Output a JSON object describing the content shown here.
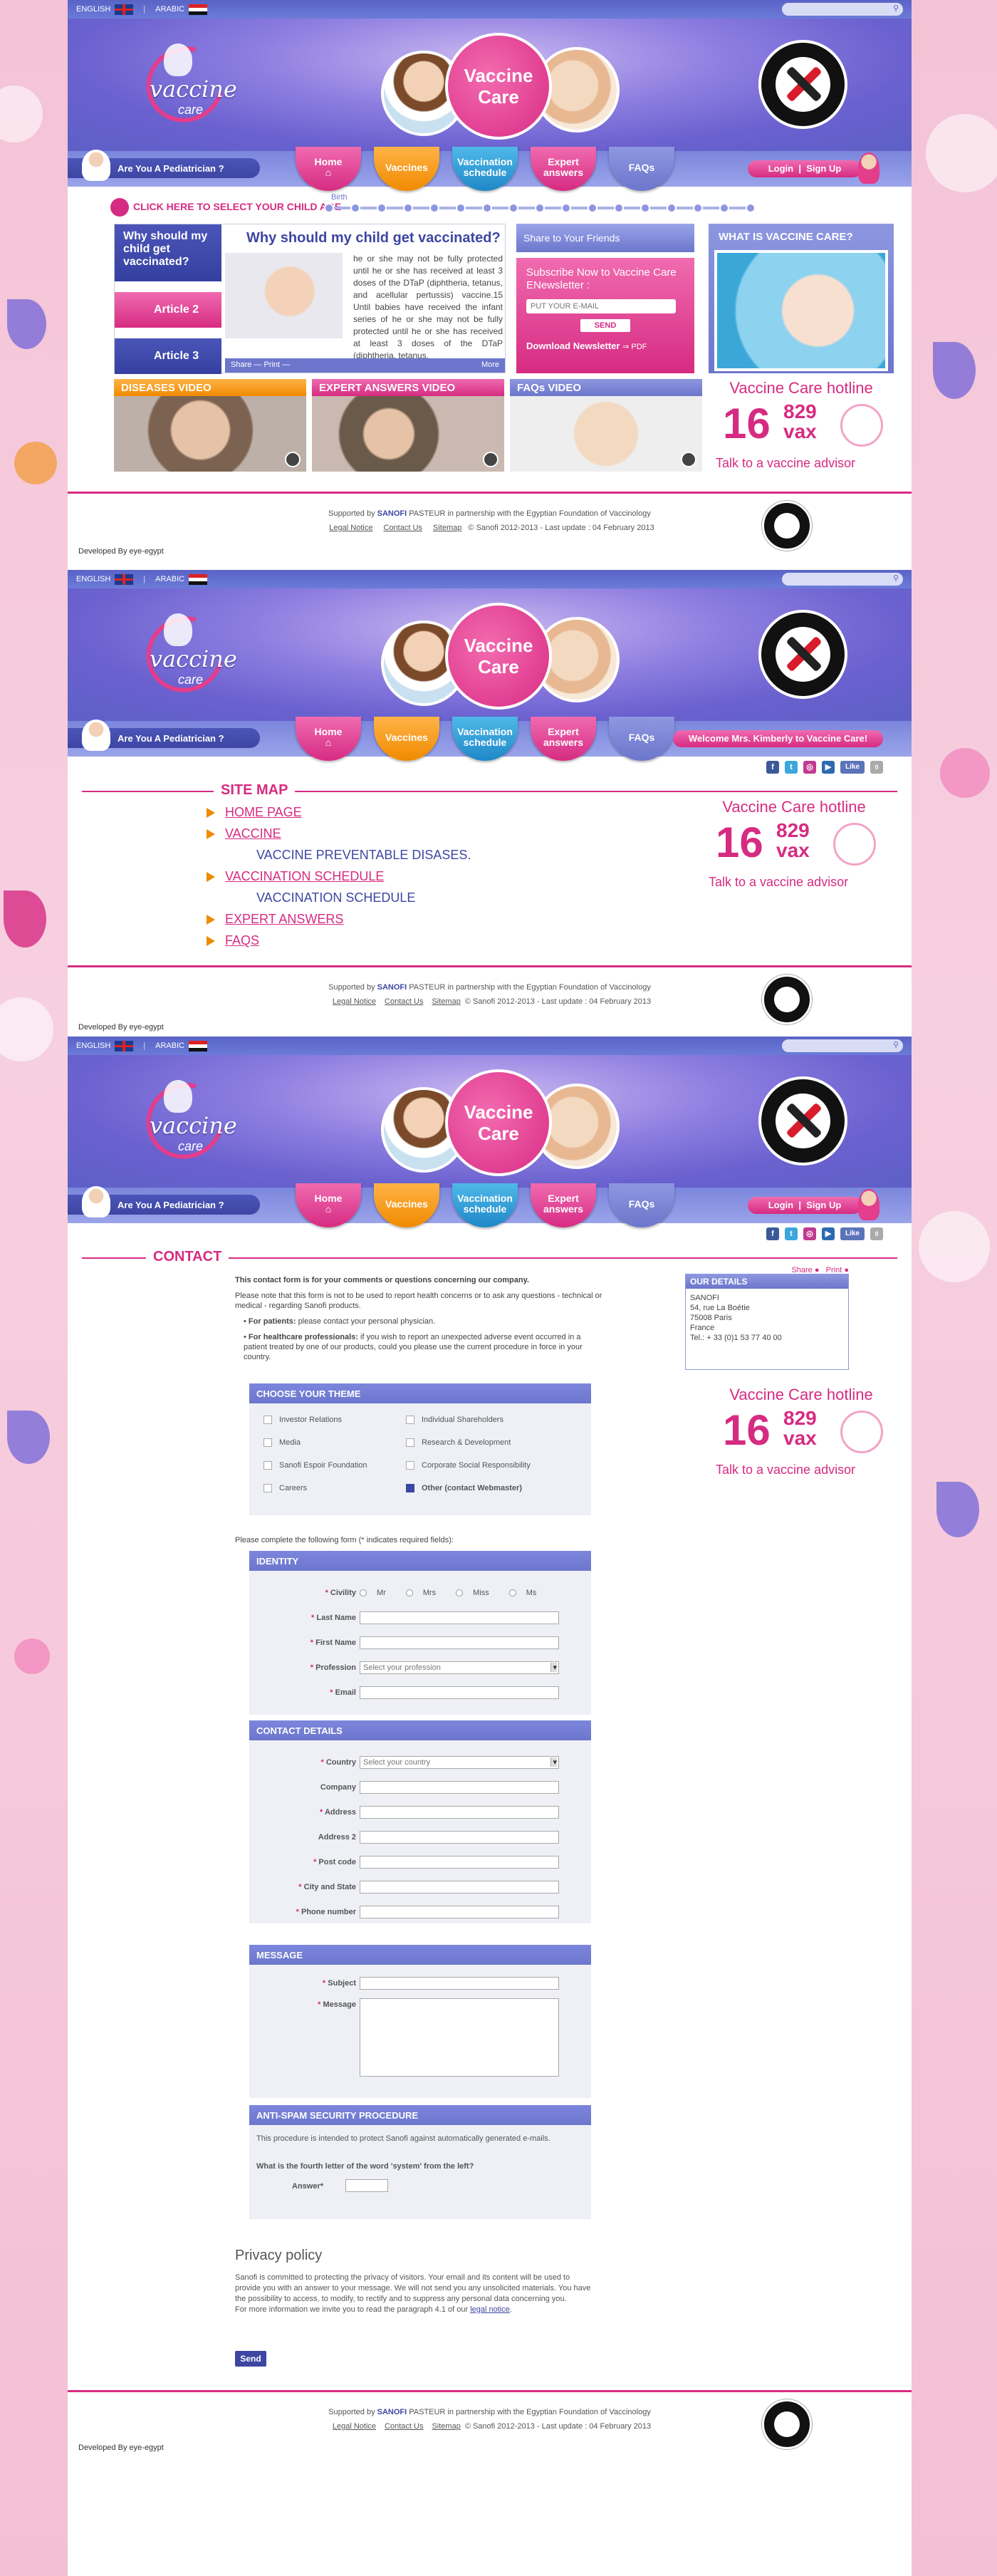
{
  "colors": {
    "brand_pink": "#d62b82",
    "brand_blue": "#3d46a2",
    "accent_orange": "#f08a00",
    "background_pink": "#f6c6da"
  },
  "top": {
    "lang_en": "ENGLISH",
    "lang_ar": "ARABIC",
    "search_placeholder": ""
  },
  "brand": {
    "logo_text": "vaccine",
    "logo_sub": "care",
    "hero_text_1": "Vaccine",
    "hero_text_2": "Care"
  },
  "nav": {
    "pediatrician": "Are You A Pediatrician ?",
    "home": "Home",
    "vaccines": "Vaccines",
    "schedule_1": "Vaccination",
    "schedule_2": "schedule",
    "expert_1": "Expert",
    "expert_2": "answers",
    "faqs": "FAQs",
    "login": "Login",
    "signup": "Sign Up",
    "welcome": "Welcome Mrs. Kimberly to Vaccine Care!"
  },
  "social": {
    "like": "Like",
    "count": "0"
  },
  "home": {
    "age_cta": "CLICK HERE TO SELECT YOUR CHILD AGE",
    "birth": "Birth",
    "article_tab_1": "Why should my child get vaccinated?",
    "article_tab_2": "Article 2",
    "article_tab_3": "Article 3",
    "article_title": "Why should my child get vaccinated?",
    "article_text": "he or she may not be fully protected until he or she has received at least 3 doses of the DTaP (diphtheria, tetanus, and acellular pertussis) vaccine.15 Until babies have received the infant series of he or she may not be fully protected until he or she has received at least 3 doses of the DTaP (diphtheria, tetanus,",
    "article_share": "Share — Print —",
    "article_more": "More",
    "share_friends": "Share to Your Friends",
    "newsletter_title": "Subscribe Now to Vaccine Care ENewsletter :",
    "email_placeholder": "PUT YOUR E-MAIL",
    "send": "SEND",
    "download": "Download Newsletter",
    "pdf": "PDF",
    "what_is": "WHAT IS VACCINE CARE?",
    "video_1": "DISEASES VIDEO",
    "video_2": "EXPERT ANSWERS VIDEO",
    "video_3": "FAQs  VIDEO"
  },
  "hotline": {
    "title": "Vaccine Care hotline",
    "number": "16",
    "num_small": "829",
    "vax": "vax",
    "sub": "Talk to a vaccine advisor"
  },
  "footer": {
    "supported": "Supported by",
    "sanofi": "SANOFI",
    "pasteur": "PASTEUR",
    "partnership": "in partnership with the Egyptian Foundation of Vaccinology",
    "legal": "Legal Notice",
    "contact": "Contact Us",
    "sitemap": "Sitemap",
    "copyright": "© Sanofi 2012-2013 - Last update : 04 February 2013",
    "developed": "Developed By eye-egypt"
  },
  "sitemap": {
    "title": "SITE MAP",
    "items": [
      {
        "label": "HOME PAGE",
        "sub": false
      },
      {
        "label": "VACCINE",
        "sub": false
      },
      {
        "label": "VACCINE PREVENTABLE DISASES.",
        "sub": true
      },
      {
        "label": "VACCINATION SCHEDULE",
        "sub": false
      },
      {
        "label": "VACCINATION SCHEDULE",
        "sub": true
      },
      {
        "label": "EXPERT ANSWERS",
        "sub": false
      },
      {
        "label": "FAQS",
        "sub": false
      }
    ]
  },
  "contact": {
    "title": "CONTACT",
    "share": "Share",
    "print": "Print",
    "intro_bold": "This contact form is for your comments or questions concerning our company.",
    "intro_2": "Please note that this form is not to be used to report health concerns or to ask any questions - technical or medical - regarding Sanofi products.",
    "patients_b": "For patients:",
    "patients": "please contact your personal physician.",
    "hcp_b": "For healthcare professionals:",
    "hcp": "if you wish to report an unexpected adverse event occurred in a patient treated by one of our products, could you please use the current procedure in force in your country.",
    "details_title": "OUR DETAILS",
    "details_lines": [
      "SANOFI",
      "54, rue La Boétie",
      "75008 Paris",
      "France",
      "Tel.: + 33 (0)1 53 77 40 00"
    ],
    "theme_title": "CHOOSE YOUR THEME",
    "themes": [
      "Investor Relations",
      "Media",
      "Sanofi Espoir Foundation",
      "Careers",
      "Individual Shareholders",
      "Research & Development",
      "Corporate Social Responsibility",
      "Other (contact Webmaster)"
    ],
    "fill_note": "Please complete the following form (* indicates required fields):",
    "identity_title": "IDENTITY",
    "civility": "Civility",
    "civ_opts": [
      "Mr",
      "Mrs",
      "Miss",
      "Ms"
    ],
    "last_name": "Last Name",
    "first_name": "First Name",
    "profession": "Profession",
    "profession_ph": "Select your profession",
    "email": "Email",
    "contact_title": "CONTACT DETAILS",
    "country": "Country",
    "country_ph": "Select your country",
    "company": "Company",
    "address": "Address",
    "address2": "Address 2",
    "post": "Post code",
    "city": "City and State",
    "phone": "Phone number",
    "message_title": "MESSAGE",
    "subject": "Subject",
    "message": "Message",
    "antispam_title": "ANTI-SPAM SECURITY PROCEDURE",
    "antispam_text": "This procedure is intended to protect Sanofi against automatically generated e-mails.",
    "question": "What is the fourth letter of the word 'system' from the left?",
    "answer": "Answer*",
    "privacy_title": "Privacy policy",
    "privacy_text": "Sanofi is committed to protecting the privacy of visitors. Your email and its content will be used to provide you with an answer to your message. We will not send you any unsolicited materials. You have the possibility to access, to modify, to rectify and to suppress any personal data concerning you.",
    "privacy_more": "For more information we invite you to read the paragraph 4.1 of our",
    "legal_link": "legal notice",
    "send": "Send"
  }
}
